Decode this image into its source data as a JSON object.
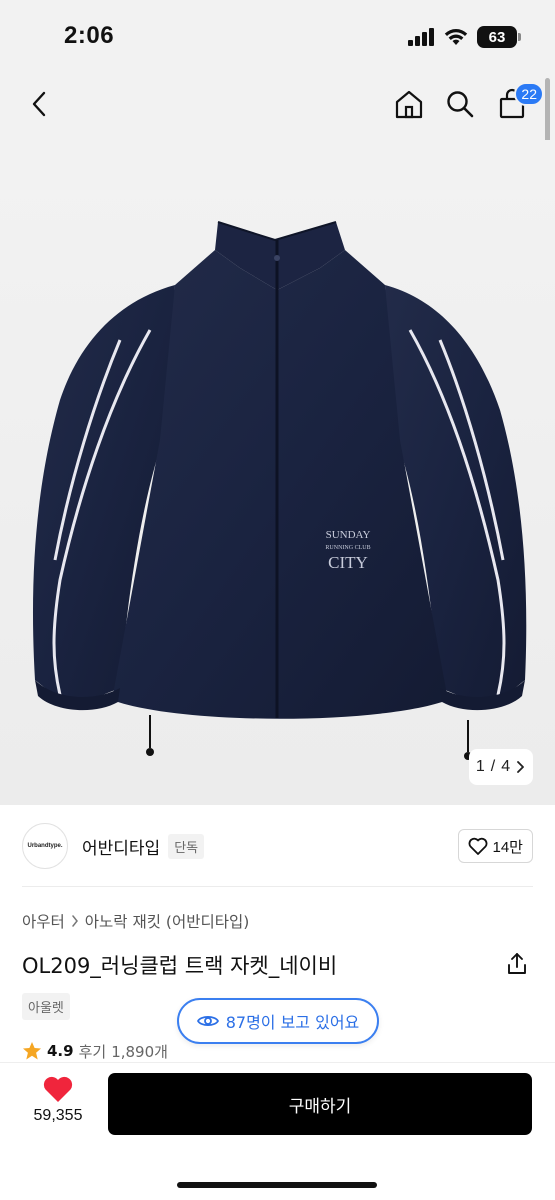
{
  "status_bar": {
    "time": "2:06",
    "battery": "63"
  },
  "nav": {
    "cart_count": "22"
  },
  "gallery": {
    "current": "1",
    "separator": "/",
    "total": "4"
  },
  "jacket_print": {
    "line1": "SUNDAY",
    "line2": "RUNNING CLUB",
    "line3": "CITY"
  },
  "brand": {
    "logo_text": "Urbandtype.",
    "name": "어반디타입",
    "tag": "단독",
    "likes": "14만"
  },
  "breadcrumb": {
    "category": "아우터",
    "subcategory": "아노락 재킷 (어반디타입)"
  },
  "product": {
    "title": "OL209_러닝클럽 트랙 자켓_네이비",
    "tag": "아울렛",
    "rating": "4.9",
    "review_label": "후기",
    "review_count": "1,890개"
  },
  "viewers": {
    "text": "87명이 보고 있어요"
  },
  "bottom": {
    "wish_count": "59,355",
    "buy_label": "구매하기"
  },
  "colors": {
    "accent_blue": "#2b7af5",
    "jacket_navy": "#1a2340",
    "heart_red": "#f0253c",
    "star": "#f5a623"
  }
}
